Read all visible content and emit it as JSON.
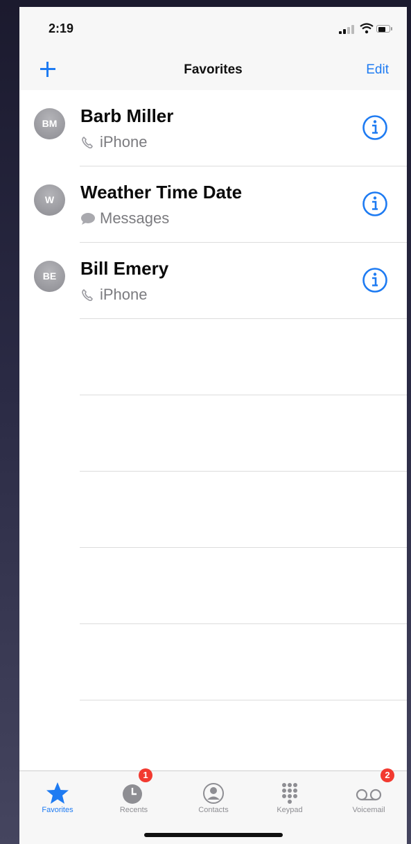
{
  "status_bar": {
    "time": "2:19"
  },
  "nav": {
    "add_label": "+",
    "title": "Favorites",
    "edit_label": "Edit"
  },
  "favorites": [
    {
      "initials": "BM",
      "name": "Barb Miller",
      "type": "iPhone",
      "type_icon": "phone-icon"
    },
    {
      "initials": "W",
      "name": "Weather Time Date",
      "type": "Messages",
      "type_icon": "message-icon"
    },
    {
      "initials": "BE",
      "name": "Bill Emery",
      "type": "iPhone",
      "type_icon": "phone-icon"
    }
  ],
  "tabs": [
    {
      "label": "Favorites",
      "icon": "star-icon",
      "active": true
    },
    {
      "label": "Recents",
      "icon": "clock-icon",
      "badge": "1"
    },
    {
      "label": "Contacts",
      "icon": "person-icon"
    },
    {
      "label": "Keypad",
      "icon": "keypad-icon"
    },
    {
      "label": "Voicemail",
      "icon": "voicemail-icon",
      "badge": "2"
    }
  ],
  "colors": {
    "accent": "#1e7bf2",
    "badge": "#f23a30",
    "secondary_text": "#7b7b7f"
  }
}
